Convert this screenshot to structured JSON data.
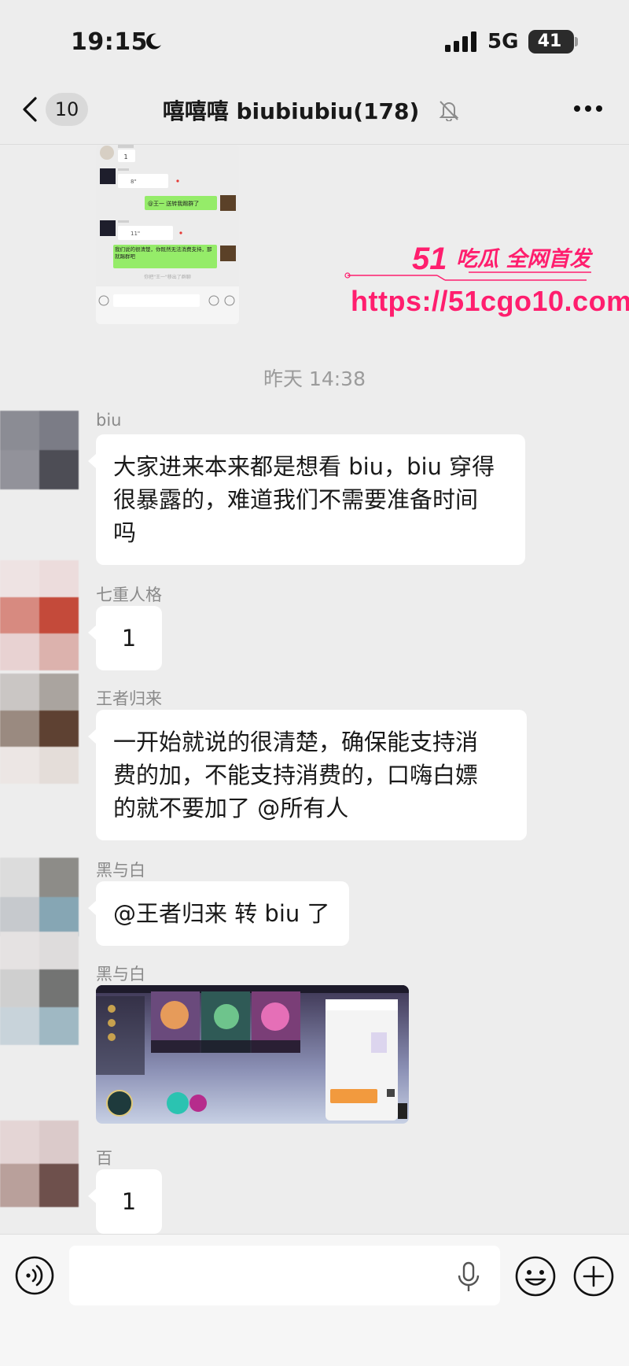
{
  "status_bar": {
    "time": "19:15",
    "network": "5G",
    "battery": "41"
  },
  "header": {
    "back_count": "10",
    "title": "嘻嘻嘻 biubiubiu(178)"
  },
  "timestamp": "昨天 14:38",
  "watermark": {
    "brand_number": "51",
    "brand_text": "吃瓜 全网首发",
    "url": "https://51cgo10.com"
  },
  "shared_screenshot": {
    "messages": [
      {
        "text": "1",
        "side": "left"
      },
      {
        "text": "8\"",
        "side": "left",
        "kind": "voice"
      },
      {
        "text": "@王一 送转我踢群了",
        "side": "right"
      },
      {
        "text": "11\"",
        "side": "left",
        "kind": "voice"
      },
      {
        "text": "我们说的很清楚，你既然无法消费支持，那就踢群吧",
        "side": "right"
      },
      {
        "text": "你把\"王一\"移出了群聊",
        "side": "system"
      }
    ]
  },
  "messages": [
    {
      "sender": "biu",
      "text_lines": [
        "大家进来本来都是想看 biu，biu 穿得",
        "很暴露的，难道我们不需要准备时间",
        "吗"
      ]
    },
    {
      "sender": "七重人格",
      "text_lines": [
        "1"
      ]
    },
    {
      "sender": "王者归来",
      "text_lines": [
        "一开始就说的很清楚，确保能支持消",
        "费的加，不能支持消费的，口嗨白嫖",
        "的就不要加了 @所有人"
      ]
    },
    {
      "sender": "黑与白",
      "text_lines": [
        "@王者归来 转 biu 了"
      ]
    },
    {
      "sender": "黑与白",
      "kind": "image"
    },
    {
      "sender": "百",
      "text_lines": [
        "1"
      ]
    }
  ],
  "colors": {
    "background": "#ededed",
    "bubble": "#ffffff",
    "green_bubble": "#95ec69",
    "watermark": "#ff1e6e",
    "sender_gray": "#8a8a8a"
  },
  "icons": [
    "moon-icon",
    "signal-icon",
    "back-icon",
    "mute-icon",
    "more-icon",
    "voice-icon",
    "mic-icon",
    "emoji-icon",
    "plus-icon"
  ]
}
